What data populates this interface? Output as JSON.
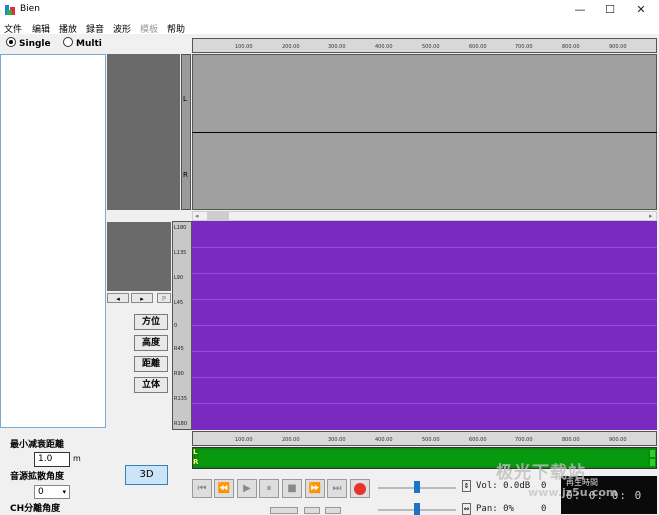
{
  "window": {
    "title": "Bien",
    "minimize": "—",
    "maximize": "☐",
    "close": "✕"
  },
  "menu": [
    "文件",
    "编辑",
    "播放",
    "録音",
    "波形",
    "模板",
    "帮助"
  ],
  "mode": {
    "single": "Single",
    "multi": "Multi"
  },
  "ruler": [
    "100.00",
    "200.00",
    "300.00",
    "400.00",
    "500.00",
    "600.00",
    "700.00",
    "800.00",
    "900.00"
  ],
  "channels": {
    "left": "L",
    "right": "R"
  },
  "scale": [
    "L180",
    "L135",
    "L90",
    "L45",
    "0",
    "R45",
    "R90",
    "R135",
    "R180"
  ],
  "mini_scroll": {
    "left": "◂",
    "right": "▸",
    "p": "P"
  },
  "position_buttons": {
    "direction": "方位",
    "height": "高度",
    "distance": "距離",
    "stereo": "立体"
  },
  "left_panel": {
    "min_distance_label": "最小减衰距離",
    "min_distance_value": "1.0",
    "unit": "m",
    "spread_label": "音源拡散角度",
    "spread_value": "0",
    "ch_sep_label": "CH分離角度",
    "btn_3d": "3D"
  },
  "transport": {
    "first": "⏮",
    "rewind": "⏪",
    "play": "▶",
    "pause": "⏸",
    "stop": "■",
    "forward": "⏩",
    "last": "⏭"
  },
  "vol": {
    "label": "Vol: 0.0dB",
    "value": "0"
  },
  "pan": {
    "label": "Pan: 0%",
    "value": "0"
  },
  "digital": {
    "title": "再生時間",
    "value": "0: 0: 0: 0"
  },
  "watermark": {
    "main": "极光下载站",
    "sub": "www.jz5u.com"
  }
}
